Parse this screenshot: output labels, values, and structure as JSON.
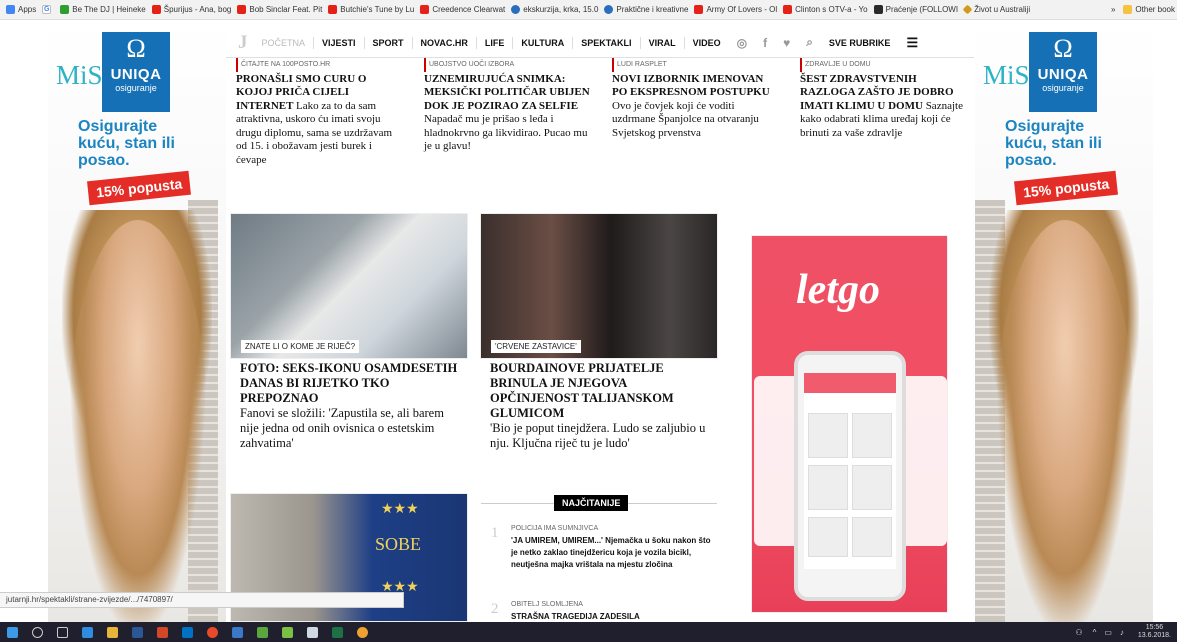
{
  "bookmarks": [
    {
      "icon": "grid",
      "label": "Apps"
    },
    {
      "icon": "google",
      "label": ""
    },
    {
      "icon": "green",
      "label": "Be The DJ | Heineke"
    },
    {
      "icon": "youtube",
      "label": "Špurijus - Ana, bog"
    },
    {
      "icon": "youtube",
      "label": "Bob Sinclar Feat. Pit"
    },
    {
      "icon": "youtube",
      "label": "Butchie's Tune by Lu"
    },
    {
      "icon": "youtube",
      "label": "Creedence Clearwat"
    },
    {
      "icon": "web",
      "label": "ekskurzija, krka, 15.0"
    },
    {
      "icon": "web",
      "label": "Praktične i kreativne"
    },
    {
      "icon": "youtube",
      "label": "Army Of Lovers - Ol"
    },
    {
      "icon": "youtube",
      "label": "Clinton s OTV-a - Yo"
    },
    {
      "icon": "dark",
      "label": "Praćenje (FOLLOWI"
    },
    {
      "icon": "diamond",
      "label": "Život u Australiji"
    }
  ],
  "bookmarks_more": "»",
  "other_bookmarks": "Other book",
  "nav": {
    "brand": "J",
    "items": [
      "POČETNA",
      "VIJESTI",
      "SPORT",
      "NOVAC.HR",
      "LIFE",
      "KULTURA",
      "SPEKTAKLI",
      "VIRAL",
      "VIDEO"
    ],
    "all_sections": "SVE RUBRIKE",
    "icons": [
      "instagram-icon",
      "facebook-icon",
      "twitter-icon",
      "search-icon",
      "menu-icon"
    ]
  },
  "ad": {
    "brand_word": "MiSli",
    "company": "UNIQA",
    "company_sub": "osiguranje",
    "slogan_line1": "Osigurajte",
    "slogan_line2": "kuću, stan ili",
    "slogan_line3": "posao.",
    "promo": "15% popusta",
    "brand_color": "#1570b5",
    "accent_color": "#e52d27"
  },
  "top_articles": [
    {
      "kicker": "ČITAJTE NA 100POSTO.HR",
      "headline": "PRONAŠLI SMO CURU O KOJOJ PRIČA CIJELI INTERNET",
      "teaser": "Lako za to da sam atraktivna, uskoro ću imati svoju drugu diplomu, sama se uzdržavam od 15. i obožavam jesti burek i ćevape"
    },
    {
      "kicker": "UBOJSTVO UOČI IZBORA",
      "headline": "UZNEMIRUJUĆA SNIMKA: MEKSIČKI POLITIČAR UBIJEN DOK JE POZIRAO ZA SELFIE",
      "teaser": "Napadač mu je prišao s leđa i hladnokrvno ga likvidirao. Pucao mu je u glavu!"
    },
    {
      "kicker": "LUDI RASPLET",
      "headline": "NOVI IZBORNIK IMENOVAN PO EKSPRESNOM POSTUPKU",
      "teaser": "Ovo je čovjek koji će voditi uzdrmane Španjolce na otvaranju Svjetskog prvenstva"
    },
    {
      "kicker": "ZDRAVLJE U DOMU",
      "headline": "ŠEST ZDRAVSTVENIH RAZLOGA ZAŠTO JE DOBRO IMATI KLIMU U DOMU",
      "teaser": "Saznajte kako odabrati klima uređaj koji će brinuti za vaše zdravlje"
    }
  ],
  "feature_articles": [
    {
      "label": "ZNATE LI O KOME JE RIJEČ?",
      "headline": "FOTO: SEKS-IKONU OSAMDESETIH DANAS BI RIJETKO TKO PREPOZNAO",
      "teaser": "Fanovi se složili: 'Zapustila se, ali barem nije jedna od onih ovisnica o estetskim zahvatima'"
    },
    {
      "label": "'CRVENE ZASTAVICE'",
      "headline": "BOURDAINOVE PRIJATELJE BRINULA JE NJEGOVA OPČINJENOST TALIJANSKOM GLUMICOM",
      "teaser": "'Bio je poput tinejdžera. Ludo se zaljubio u nju. Ključna riječ tu je ludo'"
    }
  ],
  "sobe_sign": "SOBE",
  "letgo": {
    "brand": "letgo",
    "brand_color": "#f04e63"
  },
  "najcitanije": {
    "title": "NAJČITANIJE",
    "items": [
      {
        "num": "1",
        "category": "POLICIJA IMA SUMNJIVCA",
        "text": "'JA UMIREM, UMIREM...' Njemačka u šoku nakon što je netko zaklao tinejdžericu koja je vozila bicikl, neutješna majka vrištala na mjestu zločina"
      },
      {
        "num": "2",
        "category": "OBITELJ SLOMLJENA",
        "text": "STRAŠNA TRAGEDIJA ZADESILA"
      }
    ]
  },
  "status_url": "jutarnji.hr/spektakli/strane-zvijezde/.../7470897/",
  "taskbar": {
    "time": "15:56",
    "date": "13.6.2018."
  }
}
